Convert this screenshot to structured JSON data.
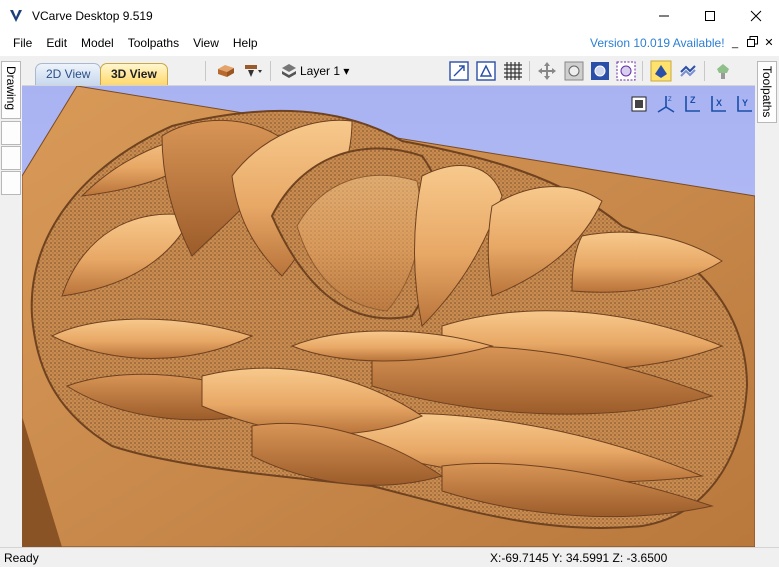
{
  "window": {
    "title": "VCarve Desktop 9.519",
    "minimize_glyph": "—",
    "maximize_glyph": "☐",
    "close_glyph": "✕"
  },
  "menu": {
    "items": [
      "File",
      "Edit",
      "Model",
      "Toolpaths",
      "View",
      "Help"
    ],
    "version_notice": "Version 10.019 Available!",
    "mdi_glyphs": [
      "_",
      "🗗",
      "✕"
    ]
  },
  "left_tabs": {
    "drawing": "Drawing"
  },
  "right_tabs": {
    "toolpaths": "Toolpaths"
  },
  "view_tabs": [
    {
      "label": "2D View",
      "active": false
    },
    {
      "label": "3D View",
      "active": true
    }
  ],
  "toolbar": {
    "layer_label": "Layer 1",
    "icons": [
      "material-icon",
      "tool-color-icon",
      "layer-stack-icon",
      "zoom-extents-icon",
      "show-bounds-icon",
      "grid-icon",
      "pan-icon",
      "zoom-box-icon",
      "zoom-fit-icon",
      "zoom-selection-icon",
      "render-toolpath-icon",
      "render-material-icon",
      "reset-preview-icon"
    ]
  },
  "viewport": {
    "scene": "3D carved lotus flower relief on wooden board",
    "view_buttons": [
      "iso-view-icon",
      "top-view-icon",
      "front-view-icon",
      "z-view-icon",
      "x-view-icon",
      "y-view-icon"
    ]
  },
  "status": {
    "text": "Ready",
    "coords": "X:-69.7145 Y: 34.5991 Z: -3.6500"
  },
  "colors": {
    "wood": "#c9894a",
    "viewport_bg": "#b4bdf6",
    "accent_link": "#2b7fd6"
  }
}
